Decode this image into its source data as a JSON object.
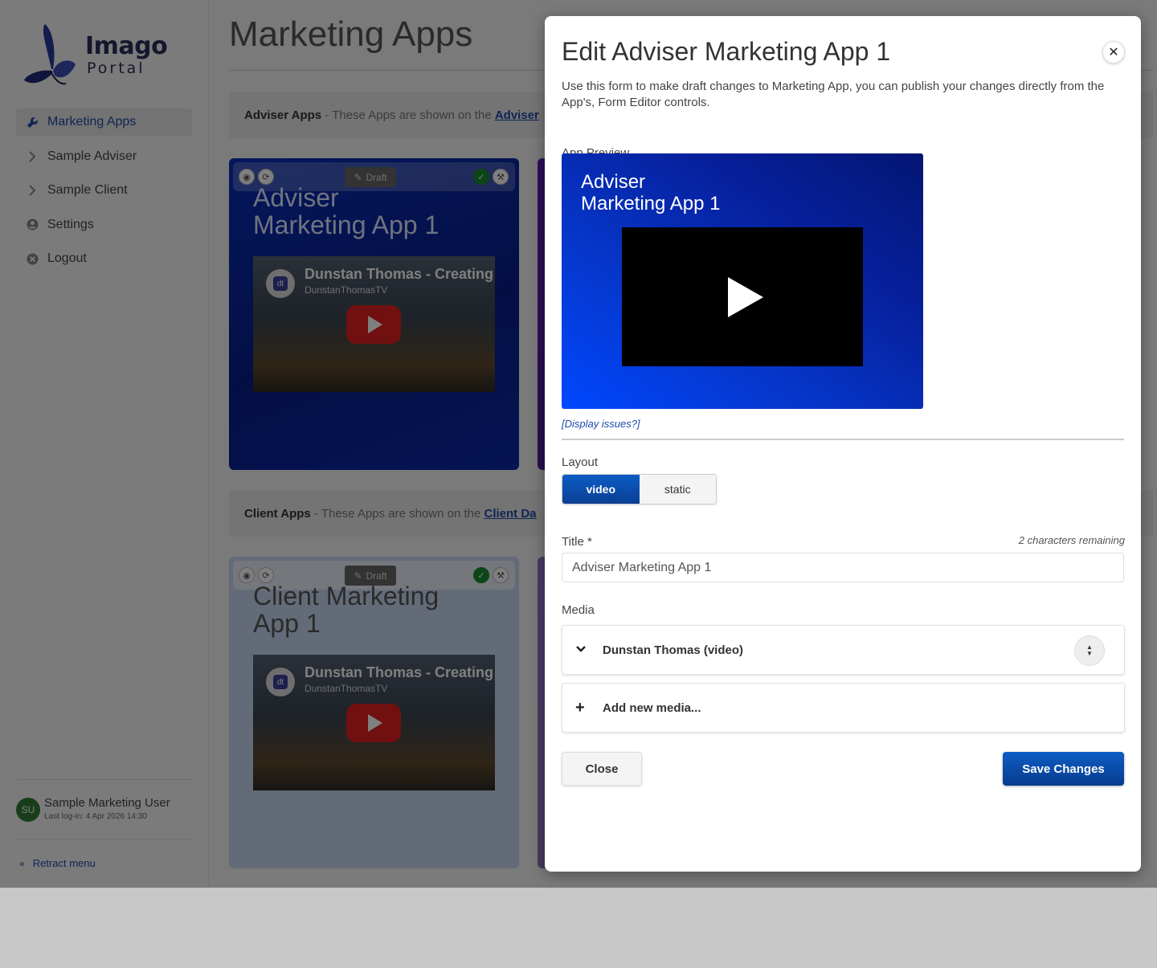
{
  "brand": {
    "name_line1": "Imago",
    "name_line2": "Portal"
  },
  "sidebar": {
    "items": [
      {
        "label": "Marketing Apps",
        "icon": "wrench-icon",
        "active": true
      },
      {
        "label": "Sample Adviser",
        "icon": "chevron-right-icon"
      },
      {
        "label": "Sample Client",
        "icon": "chevron-right-icon"
      },
      {
        "label": "Settings",
        "icon": "user-circle-icon"
      },
      {
        "label": "Logout",
        "icon": "close-circle-icon"
      }
    ],
    "user": {
      "initials": "SU",
      "name": "Sample Marketing User",
      "last_login": "Last log-in: 4 Apr 2026 14:30"
    },
    "retract_label": "Retract menu"
  },
  "main": {
    "title": "Marketing Apps",
    "adviser_section": {
      "label": "Adviser Apps",
      "text": " - These Apps are shown on the ",
      "link": "Adviser"
    },
    "client_section": {
      "label": "Client Apps",
      "text": " - These Apps are shown on the ",
      "link": "Client Da"
    },
    "draft_label": "Draft",
    "cards": [
      {
        "title": "Adviser\nMarketing App 1",
        "video_title": "Dunstan Thomas - Creating",
        "channel": "DunstanThomasTV"
      },
      {
        "title": "Client Marketing\nApp 1",
        "video_title": "Dunstan Thomas - Creating",
        "channel": "DunstanThomasTV"
      }
    ]
  },
  "modal": {
    "title": "Edit Adviser Marketing App 1",
    "description": "Use this form to make draft changes to Marketing App, you can publish your changes directly from the App's, Form Editor controls.",
    "preview_label": "App Preview",
    "preview_title": "Adviser\nMarketing App 1",
    "display_issues": "[Display issues?]",
    "layout_label": "Layout",
    "layout_options": [
      "video",
      "static"
    ],
    "layout_selected": "video",
    "title_label": "Title *",
    "chars_remaining": "2 characters remaining",
    "title_value": "Adviser Marketing App 1",
    "media_label": "Media",
    "media_item": "Dunstan Thomas (video)",
    "add_media": "Add new media...",
    "close_label": "Close",
    "save_label": "Save Changes"
  },
  "colors": {
    "primary": "#0a3f94",
    "link": "#1d4aa8",
    "preview_bg": "#0636c9"
  }
}
